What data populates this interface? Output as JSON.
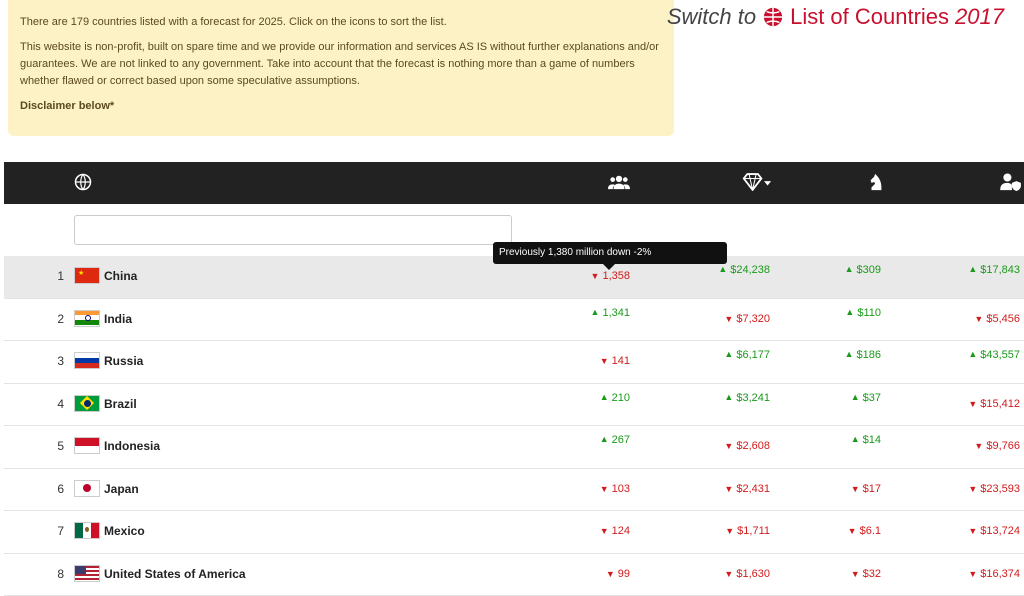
{
  "info": {
    "line1": "There are 179 countries listed with a forecast for 2025. Click on the icons to sort the list.",
    "line2": "This website is non-profit, built on spare time and we provide our information and services AS IS without further explanations and/or guarantees. We are not linked to any government. Take into account that the forecast is nothing more than a game of numbers whether flawed or correct based upon some speculative assumptions.",
    "disclaimer": "Disclaimer below*"
  },
  "switch": {
    "label": "Switch to",
    "link": "List of Countries",
    "year": "2017"
  },
  "header_icons": [
    "globe-icon",
    "population-icon",
    "diamond-sort-icon",
    "chess-knight-icon",
    "user-shield-icon"
  ],
  "tooltip": "Previously 1,380 million down -2%",
  "rows": [
    {
      "rank": "1",
      "name": "China",
      "flag": "cn",
      "pop": "1,358",
      "pop_dir": "dn",
      "gdp": "$24,238",
      "gdp_dir": "up",
      "mil": "$309",
      "mil_dir": "up",
      "ppp": "$17,843",
      "ppp_dir": "up"
    },
    {
      "rank": "2",
      "name": "India",
      "flag": "in",
      "pop": "1,341",
      "pop_dir": "up",
      "gdp": "$7,320",
      "gdp_dir": "dn",
      "mil": "$110",
      "mil_dir": "up",
      "ppp": "$5,456",
      "ppp_dir": "dn"
    },
    {
      "rank": "3",
      "name": "Russia",
      "flag": "ru",
      "pop": "141",
      "pop_dir": "dn",
      "gdp": "$6,177",
      "gdp_dir": "up",
      "mil": "$186",
      "mil_dir": "up",
      "ppp": "$43,557",
      "ppp_dir": "up"
    },
    {
      "rank": "4",
      "name": "Brazil",
      "flag": "br",
      "pop": "210",
      "pop_dir": "up",
      "gdp": "$3,241",
      "gdp_dir": "up",
      "mil": "$37",
      "mil_dir": "up",
      "ppp": "$15,412",
      "ppp_dir": "dn"
    },
    {
      "rank": "5",
      "name": "Indonesia",
      "flag": "id",
      "pop": "267",
      "pop_dir": "up",
      "gdp": "$2,608",
      "gdp_dir": "dn",
      "mil": "$14",
      "mil_dir": "up",
      "ppp": "$9,766",
      "ppp_dir": "dn"
    },
    {
      "rank": "6",
      "name": "Japan",
      "flag": "jp",
      "pop": "103",
      "pop_dir": "dn",
      "gdp": "$2,431",
      "gdp_dir": "dn",
      "mil": "$17",
      "mil_dir": "dn",
      "ppp": "$23,593",
      "ppp_dir": "dn"
    },
    {
      "rank": "7",
      "name": "Mexico",
      "flag": "mx",
      "pop": "124",
      "pop_dir": "dn",
      "gdp": "$1,711",
      "gdp_dir": "dn",
      "mil": "$6.1",
      "mil_dir": "dn",
      "ppp": "$13,724",
      "ppp_dir": "dn"
    },
    {
      "rank": "8",
      "name": "United States of America",
      "flag": "us",
      "pop": "99",
      "pop_dir": "dn",
      "gdp": "$1,630",
      "gdp_dir": "dn",
      "mil": "$32",
      "mil_dir": "dn",
      "ppp": "$16,374",
      "ppp_dir": "dn"
    }
  ],
  "colors": {
    "up": "#1a9a1a",
    "down": "#d11c1c",
    "header_bg": "#222222",
    "info_bg": "#fdf1c6",
    "accent": "#c8102e"
  }
}
